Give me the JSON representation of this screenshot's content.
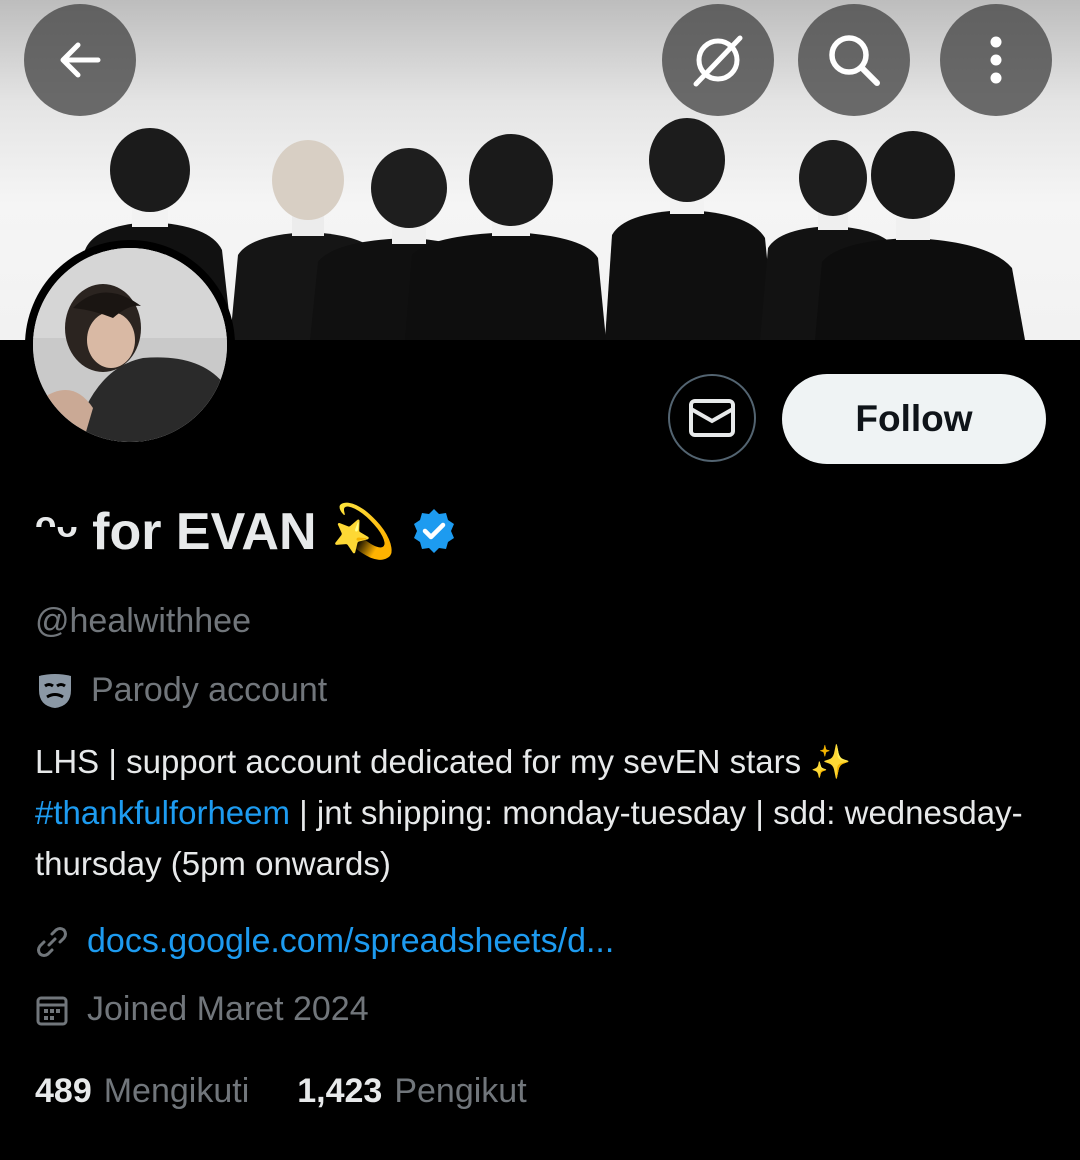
{
  "header": {
    "back_icon": "arrow-left-icon",
    "grok_icon": "grok-icon",
    "search_icon": "search-icon",
    "more_icon": "more-vertical-icon"
  },
  "profile": {
    "display_name": "ᵔᵕ for EVAN 💫",
    "verified": true,
    "handle": "@healwithhee",
    "parody_label": "Parody account",
    "bio_line1": "LHS | support account dedicated for my sevEN stars ✨",
    "bio_hashtag": "#thankfulforheem",
    "bio_rest": " | jnt shipping: monday-tuesday | sdd: wednesday-thursday (5pm onwards)",
    "link": "docs.google.com/spreadsheets/d...",
    "joined": "Joined Maret 2024",
    "following_count": "489",
    "following_label": "Mengikuti",
    "followers_count": "1,423",
    "followers_label": "Pengikut"
  },
  "actions": {
    "follow_label": "Follow",
    "message_icon": "envelope-icon"
  },
  "colors": {
    "accent": "#1d9bf0",
    "muted": "#71767b",
    "background": "#000000"
  }
}
